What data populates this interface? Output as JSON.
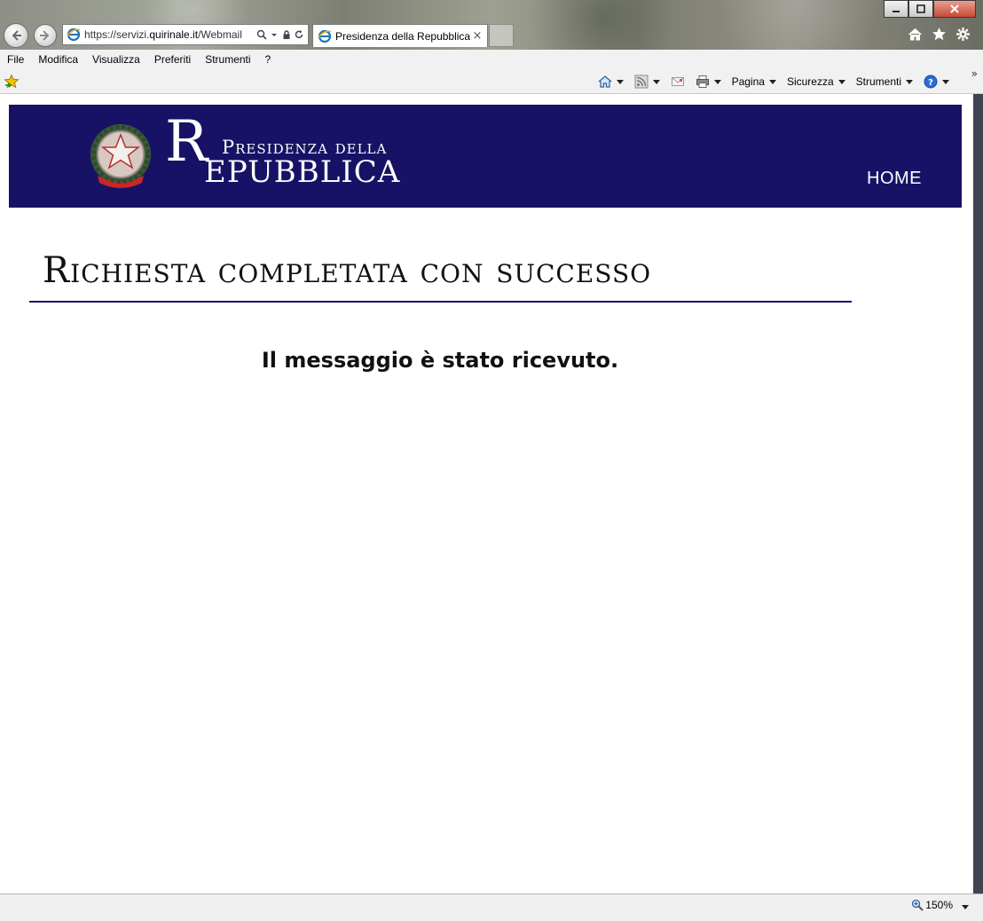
{
  "browser": {
    "address": {
      "url_prefix": "https://servizi.",
      "url_domain": "quirinale.it",
      "url_suffix": "/Webmail"
    },
    "tab": {
      "title": "Presidenza della Repubblica...",
      "close": "×"
    },
    "menu": [
      "File",
      "Modifica",
      "Visualizza",
      "Preferiti",
      "Strumenti",
      "?"
    ],
    "command_bar": {
      "pagina": "Pagina",
      "sicurezza": "Sicurezza",
      "strumenti": "Strumenti",
      "overflow": "»"
    },
    "status": {
      "zoom": "150%"
    }
  },
  "site": {
    "brand": {
      "r": "R",
      "line1": "Presidenza della",
      "line2": "EPUBBLICA"
    },
    "nav": {
      "home": "HOME"
    },
    "page_title": "Richiesta completata con successo",
    "message": "Il messaggio è stato ricevuto."
  },
  "colors": {
    "header_bg": "#181266",
    "header_text": "#ffffff",
    "rule": "#181266"
  }
}
